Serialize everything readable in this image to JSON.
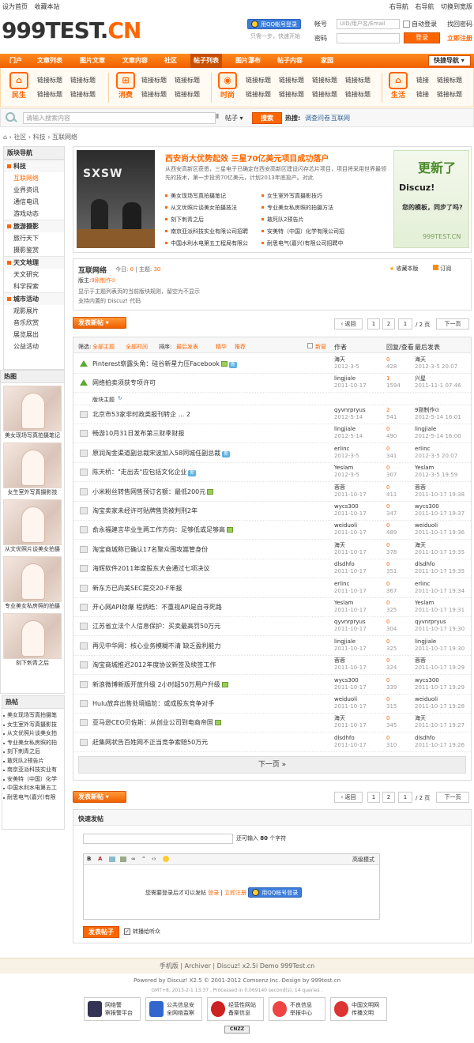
{
  "topbar": {
    "left": [
      "设为首页",
      "收藏本站"
    ],
    "right": [
      "右导航",
      "右导航",
      "切换到宽版"
    ]
  },
  "logo": {
    "main": "999TEST.",
    "suffix": "CN"
  },
  "login": {
    "qq_label": "用QQ帐号登录",
    "qq_sub": "只需一步，快速开始",
    "user_label": "帐号",
    "user_placeholder": "UID/用户名/Email",
    "pass_label": "密码",
    "auto": "自动登录",
    "retrieve": "找回密码",
    "login_btn": "登录",
    "register": "立即注册"
  },
  "nav": {
    "items": [
      "门户",
      "文章列表",
      "图片文章",
      "文章内容",
      "社区",
      "帖子列表",
      "图片瀑布",
      "帖子内容",
      "家园"
    ],
    "active_index": 5,
    "quick": "快捷导航"
  },
  "band": {
    "groups": [
      {
        "name": "民生",
        "icon": "house-icon",
        "links": [
          "链接标题",
          "链接标题",
          "链接标题",
          "链接标题"
        ]
      },
      {
        "name": "消费",
        "icon": "cart-icon",
        "links": [
          "链接标题",
          "链接标题",
          "链接标题",
          "链接标题"
        ]
      },
      {
        "name": "时尚",
        "icon": "camera-icon",
        "links": [
          "链接标题",
          "链接标题",
          "链接标题",
          "链接标题",
          "链接标题",
          "链接标题",
          "链接标题",
          "链接标题"
        ]
      },
      {
        "name": "生活",
        "icon": "home-icon",
        "links": [
          "链接",
          "链接标题",
          "链接",
          "链接标题"
        ]
      }
    ],
    "link": "链接标题"
  },
  "search": {
    "placeholder": "请输入搜索内容",
    "type": "帖子",
    "button": "搜索",
    "hot_label": "热搜:",
    "hot": [
      "调查问卷",
      "互联网"
    ]
  },
  "crumb": [
    "社区",
    "科技",
    "互联网络"
  ],
  "sidebar": {
    "title": "版块导航",
    "groups": [
      {
        "name": "科技",
        "items": [
          "互联网络",
          "业界资讯",
          "通信电讯",
          "游戏动态"
        ]
      },
      {
        "name": "旅游摄影",
        "items": [
          "旅行天下",
          "摄影鉴赏"
        ]
      },
      {
        "name": "天文地理",
        "items": [
          "天文研究",
          "科学探索"
        ]
      },
      {
        "name": "城市活动",
        "items": [
          "观影展片",
          "音乐欣赏",
          "展览展出",
          "公益活动"
        ]
      }
    ]
  },
  "hot_images": {
    "title": "热图",
    "items": [
      "美女现场写真拍摄笔记",
      "女生室外写真摄影技",
      "从文优照片谈美女拍摄",
      "专业美女私房照的拍摄",
      "刻下刺青之后"
    ]
  },
  "hot_posts": {
    "title": "热帖",
    "items": [
      "美女现场写真拍摄笔",
      "女生室外写真摄影技",
      "从文优照片谈美女拍",
      "专业美女私房照的拍",
      "刻下刺青之后",
      "敢死队2预告片",
      "南京亚派科技实业有",
      "安美特（中国）化学",
      "中国水利水电第五工",
      "耐思电气(嘉兴)有限"
    ]
  },
  "featured": {
    "title": "西安尚大优势起效 三星70亿美元项目成功落户",
    "desc": "从西安高新区获悉，三星电子已确定在西安高新区建设闪存芯片项目，项目将采用世界最领先的技术，第一步投资70亿美元，计划2013年底投产。对此",
    "list_left": [
      "美女现场写真拍摄笔记",
      "从文优照片谈美女拍摄技法",
      "刻下刺青之后",
      "南京亚派科技实业有限公司招聘",
      "中国水利水电第五工程局有限公"
    ],
    "list_right": [
      "女生室外写真摄影技巧",
      "专业美女私房照的拍摄方法",
      "敢死队2预告片",
      "安美特（中国）化学有限公司招",
      "耐思电气(嘉兴)有限公司招聘中"
    ],
    "img_text": "SXSW",
    "ad_title": "更新了",
    "ad_brand": "Discuz!",
    "ad_slogan": "您的模板，同步了吗?",
    "ad_site": "999TEST.CN"
  },
  "forum": {
    "name": "互联网络",
    "today_label": "今日:",
    "today": "0",
    "threads_label": "主题:",
    "threads": "30",
    "fav": "收藏本版",
    "rss": "订阅",
    "mod_label": "版主:",
    "mod": "9刚制作⊙",
    "rules": [
      "显示于主题列表页的当前版块规则，留空为不显示",
      "支持内置的 Discuz! 代码"
    ]
  },
  "pager": {
    "post": "发表新帖",
    "back": "返回",
    "pages": [
      "1",
      "2"
    ],
    "current": "1",
    "total": "/ 2 页",
    "next": "下一页"
  },
  "filter": {
    "items": [
      "全部主题",
      "全部时间",
      "排序:",
      "最后发表",
      "精华",
      "推荐"
    ],
    "new": "新窗",
    "col_author": "作者",
    "col_reply": "回复/查看",
    "col_last": "最后发表"
  },
  "threads": [
    {
      "title": "Pinterest崭露头角：硅谷新星力压Facebook",
      "type": "up",
      "badge": "新",
      "img": true,
      "author": "海天",
      "adate": "2012-3-5",
      "r": "0",
      "v": "428",
      "last": "海天",
      "ldate": "2012-3-5 20:07"
    },
    {
      "title": "网络拍卖须获专项许可",
      "type": "up",
      "author": "lingjiale",
      "adate": "2011-10-17",
      "r": "1",
      "v": "1594",
      "last": "兴星",
      "ldate": "2011-11-1 07:46"
    },
    {
      "title": "北京市53家非时政类报刊转企 ... 2",
      "author": "qyvnrpryus",
      "adate": "2012-5-14",
      "r": "2",
      "v": "541",
      "last": "9刚制作⊙",
      "ldate": "2012-5-14 16:01"
    },
    {
      "title": "畅游10月31日发布第三财季财报",
      "author": "lingjiale",
      "adate": "2012-5-14",
      "r": "0",
      "v": "490",
      "last": "lingjiale",
      "ldate": "2012-5-14 16:00"
    },
    {
      "title": "原润淘金渠道副总裁宋波加入58同城任副总裁",
      "badge": "新",
      "author": "erlinc",
      "adate": "2012-3-5",
      "r": "0",
      "v": "341",
      "last": "erlinc",
      "ldate": "2012-3-5 20:07"
    },
    {
      "title": "陈天桥：\"走出去\"应包括文化企业",
      "badge": "新",
      "author": "Yeslam",
      "adate": "2012-3-5",
      "r": "0",
      "v": "307",
      "last": "Yeslam",
      "ldate": "2012-3-5 19:59"
    },
    {
      "title": "小米粉丝转售网售预订名额：最低200元",
      "img": true,
      "author": "蓉蓉",
      "adate": "2011-10-17",
      "r": "0",
      "v": "411",
      "last": "蓉蓉",
      "ldate": "2011-10-17 19:38"
    },
    {
      "title": "淘宝卖家未经许可贴牌售货被判刑2年",
      "author": "wycs300",
      "adate": "2011-10-17",
      "r": "0",
      "v": "347",
      "last": "wycs300",
      "ldate": "2011-10-17 19:37"
    },
    {
      "title": "俞永福建言毕业生两工作方向：足够低或足够高",
      "img": true,
      "author": "weiduoli",
      "adate": "2011-10-17",
      "r": "0",
      "v": "489",
      "last": "weiduoli",
      "ldate": "2011-10-17 19:36"
    },
    {
      "title": "淘宝商城称已确认17名聚众围攻嵩管身份",
      "author": "海天",
      "adate": "2011-10-17",
      "r": "0",
      "v": "378",
      "last": "海天",
      "ldate": "2011-10-17 19:35"
    },
    {
      "title": "海辉软件2011年度股东大会通过七项决议",
      "author": "dlsdhfo",
      "adate": "2011-10-17",
      "r": "0",
      "v": "351",
      "last": "dlsdhfo",
      "ldate": "2011-10-17 19:35"
    },
    {
      "title": "新东方已向美SEC提交20-F年报",
      "author": "erlinc",
      "adate": "2011-10-17",
      "r": "0",
      "v": "367",
      "last": "erlinc",
      "ldate": "2011-10-17 19:34"
    },
    {
      "title": "开心网API劲爆 程炳皓：不重视API是自寻死路",
      "author": "Yeslam",
      "adate": "2011-10-17",
      "r": "0",
      "v": "325",
      "last": "Yeslam",
      "ldate": "2011-10-17 19:31"
    },
    {
      "title": "江苏省立法个人信息保护：买卖最高罚50万元",
      "author": "qyvnrpryus",
      "adate": "2011-10-17",
      "r": "0",
      "v": "304",
      "last": "qyvnrpryus",
      "ldate": "2011-10-17 19:30"
    },
    {
      "title": "再见中华网：核心业务模糊不清 缺乏盈利能力",
      "author": "lingjiale",
      "adate": "2011-10-17",
      "r": "0",
      "v": "325",
      "last": "lingjiale",
      "ldate": "2011-10-17 19:30"
    },
    {
      "title": "淘宝商城推迟2012年度协议新签及续签工作",
      "author": "蓉蓉",
      "adate": "2011-10-17",
      "r": "0",
      "v": "324",
      "last": "蓉蓉",
      "ldate": "2011-10-17 19:29"
    },
    {
      "title": "新浪微博新版开放升级 2小时超50万用户升级",
      "img": true,
      "author": "wycs300",
      "adate": "2011-10-17",
      "r": "0",
      "v": "339",
      "last": "wycs300",
      "ldate": "2011-10-17 19:29"
    },
    {
      "title": "Hulu放弃出售处境尴尬：或成股东竞争对手",
      "author": "weiduoli",
      "adate": "2011-10-17",
      "r": "0",
      "v": "315",
      "last": "weiduoli",
      "ldate": "2011-10-17 19:28"
    },
    {
      "title": "亚马逊CEO贝佐斯：从创业公司到电商帝国",
      "img": true,
      "author": "海天",
      "adate": "2011-10-17",
      "r": "0",
      "v": "345",
      "last": "海天",
      "ldate": "2011-10-17 19:27"
    },
    {
      "title": "赶集网状告百姓网不正当竞争索赔50万元",
      "author": "dlsdhfo",
      "adate": "2011-10-17",
      "r": "0",
      "v": "310",
      "last": "dlsdhfo",
      "ldate": "2011-10-17 19:26"
    }
  ],
  "separator": "版块主题",
  "next_page": "下一页 »",
  "quickpost": {
    "title": "快速发帖",
    "hint_pre": "还可输入",
    "hint_num": "80",
    "hint_post": "个字符",
    "advanced": "高级模式",
    "login_pre": "您需要登录后才可以发帖",
    "login": "登录",
    "register": "立即注册",
    "qq": "用QQ帐号登录",
    "submit": "发表帖子",
    "sync": "转播给听众"
  },
  "footer": {
    "links": [
      "手机版",
      "Archiver",
      "Discuz! x2.5i Demo 999Test.cn"
    ],
    "powered": "Powered by Discuz! X2.5 © 2001-2012 Comsenz Inc. Design by 999test.cn",
    "gmt": "GMT+8, 2013-2-1 13:37 , Processed in 0.069140 second(s), 14 queries .",
    "badges": [
      [
        "网络警",
        "察报警平台"
      ],
      [
        "公共信息安",
        "全网络监察"
      ],
      [
        "经营性网站",
        "备案信息"
      ],
      [
        "不良信息",
        "举报中心"
      ],
      [
        "中国文明网",
        "传播文明"
      ]
    ],
    "cnzz": "CNZZ"
  },
  "colors": {
    "accent": "#ff6600",
    "link": "#336699",
    "nav": "#f06000"
  }
}
